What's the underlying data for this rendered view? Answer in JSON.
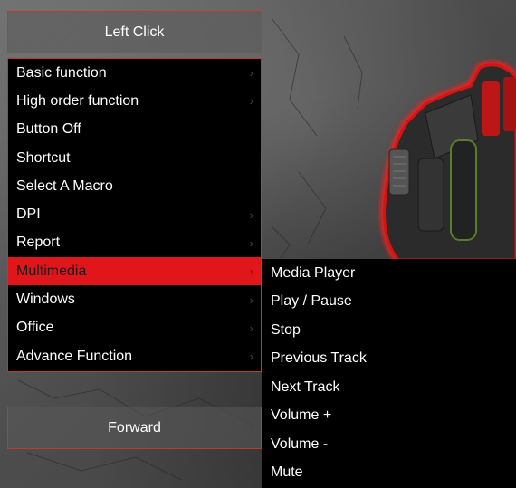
{
  "top_button": {
    "label": "Left Click"
  },
  "bottom_button": {
    "label": "Forward"
  },
  "menu": {
    "items": [
      {
        "label": "Basic function",
        "chevron": "›",
        "has_submenu": true
      },
      {
        "label": "High order function",
        "chevron": "›",
        "has_submenu": true
      },
      {
        "label": "Button Off",
        "chevron": "",
        "has_submenu": false
      },
      {
        "label": "Shortcut",
        "chevron": "",
        "has_submenu": false
      },
      {
        "label": "Select A Macro",
        "chevron": "",
        "has_submenu": false
      },
      {
        "label": "DPI",
        "chevron": "›",
        "has_submenu": true
      },
      {
        "label": "Report",
        "chevron": "›",
        "has_submenu": true
      },
      {
        "label": "Multimedia",
        "chevron": "›",
        "has_submenu": true,
        "active": true
      },
      {
        "label": "Windows",
        "chevron": "›",
        "has_submenu": true
      },
      {
        "label": "Office",
        "chevron": "›",
        "has_submenu": true
      },
      {
        "label": "Advance Function",
        "chevron": "›",
        "has_submenu": true
      }
    ]
  },
  "submenu": {
    "items": [
      {
        "label": "Media Player"
      },
      {
        "label": "Play / Pause"
      },
      {
        "label": "Stop"
      },
      {
        "label": "Previous Track"
      },
      {
        "label": "Next Track"
      },
      {
        "label": "Volume +"
      },
      {
        "label": "Volume -"
      },
      {
        "label": "Mute"
      }
    ]
  },
  "colors": {
    "accent_red": "#e0161a",
    "border_red": "#c0392b",
    "menu_bg": "#000000",
    "text": "#ffffff"
  },
  "icons": {
    "submenu_indicator": "chevron-right-icon"
  }
}
